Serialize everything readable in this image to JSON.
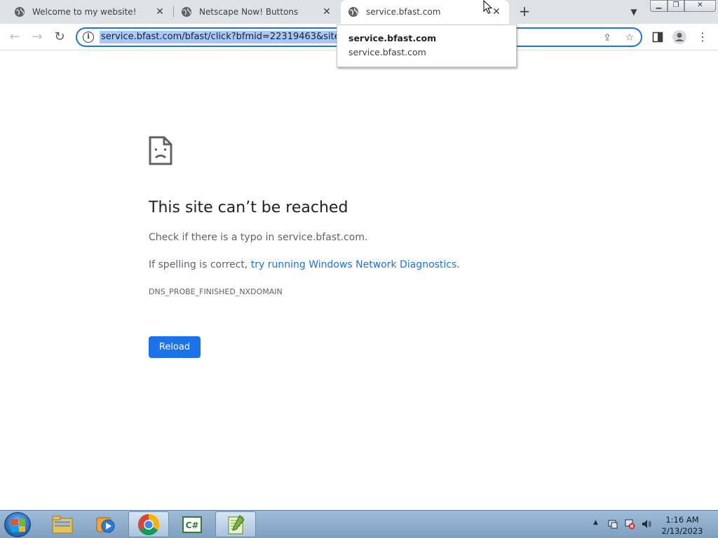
{
  "browser": {
    "tabs": [
      {
        "title": "Welcome to my website!",
        "active": false
      },
      {
        "title": "Netscape Now! Buttons",
        "active": false
      },
      {
        "title": "service.bfast.com",
        "active": true
      }
    ],
    "omnibox": {
      "url": "service.bfast.com/bfast/click?bfmid=22319463&siteid="
    },
    "dropdown": {
      "line1": "service.bfast.com",
      "line2": "service.bfast.com"
    }
  },
  "error_page": {
    "title": "This site can’t be reached",
    "line1": "Check if there is a typo in service.bfast.com.",
    "line2_prefix": "If spelling is correct, ",
    "line2_link": "try running Windows Network Diagnostics",
    "line2_suffix": ".",
    "error_code": "DNS_PROBE_FINISHED_NXDOMAIN",
    "reload_label": "Reload"
  },
  "taskbar": {
    "apps": [
      "file-explorer",
      "media-player",
      "chrome",
      "csharp-editor",
      "notepad-plus-plus"
    ],
    "clock": {
      "time": "1:16 AM",
      "date": "2/13/2023"
    }
  },
  "colors": {
    "accent": "#1a73e8",
    "link": "#1a73e8",
    "tab_strip": "#dee1e6"
  }
}
